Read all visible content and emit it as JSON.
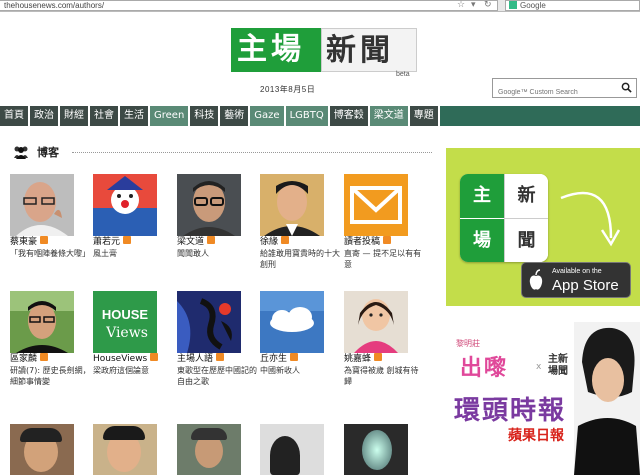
{
  "browser": {
    "url": "thehousenews.com/authors/",
    "search_engine": "Google"
  },
  "site": {
    "logo_left": "主場",
    "logo_right": "新聞",
    "beta": "beta",
    "date": "2013年8月5日",
    "search_placeholder": "Google™ Custom Search"
  },
  "nav": [
    {
      "label": "首頁",
      "style": "dark"
    },
    {
      "label": "政治",
      "style": "dark"
    },
    {
      "label": "財經",
      "style": "dark"
    },
    {
      "label": "社會",
      "style": "dark"
    },
    {
      "label": "生活",
      "style": "dark"
    },
    {
      "label": "Green",
      "style": "light"
    },
    {
      "label": "科技",
      "style": "dark"
    },
    {
      "label": "藝術",
      "style": "dark"
    },
    {
      "label": "Gaze",
      "style": "light"
    },
    {
      "label": "LGBTQ",
      "style": "light"
    },
    {
      "label": "博客穀",
      "style": "dark"
    },
    {
      "label": "梁文道",
      "style": "light"
    },
    {
      "label": "專題",
      "style": "dark"
    }
  ],
  "section": {
    "title": "博客"
  },
  "authors": [
    {
      "name": "蔡東豪",
      "desc": "「我有嗰陣養條大嚟」",
      "avatar": "bald-man"
    },
    {
      "name": "蕭若元",
      "desc": "風土膏",
      "avatar": "clown"
    },
    {
      "name": "梁文道",
      "desc": "聞聞敢人",
      "avatar": "glasses-man"
    },
    {
      "name": "徐緣",
      "desc": "給誰敢用寶貴時的十大創刑",
      "avatar": "young-man"
    },
    {
      "name": "讀者投稿",
      "desc": "直寄 — 提不足以有有意",
      "avatar": "envelope"
    },
    {
      "name": "區家麟",
      "desc": "研讀(7): 歷史長劍網，細節事情變",
      "avatar": "man-green"
    },
    {
      "name": "HouseViews",
      "desc": "梁政府這個論意",
      "avatar": "houseviews"
    },
    {
      "name": "主場人語",
      "desc": "東歌型在歷歷中國記的自由之歌",
      "avatar": "art"
    },
    {
      "name": "丘亦生",
      "desc": "中國新收人",
      "avatar": "cloud"
    },
    {
      "name": "姚嘉蜂",
      "desc": "為寶得被歲 創城有待歸",
      "avatar": "child"
    }
  ],
  "promo": {
    "tile_tl": "主",
    "tile_tr": "新",
    "tile_bl": "場",
    "tile_br": "聞",
    "appstore_line1": "Available on the",
    "appstore_line2": "App Store"
  },
  "ad": {
    "top": "黎明莊",
    "pink": "出嚟",
    "x": "x",
    "logo": "主新\n場聞",
    "main": "環頭時報",
    "apple": "蘋果日報",
    "sub": "場"
  }
}
